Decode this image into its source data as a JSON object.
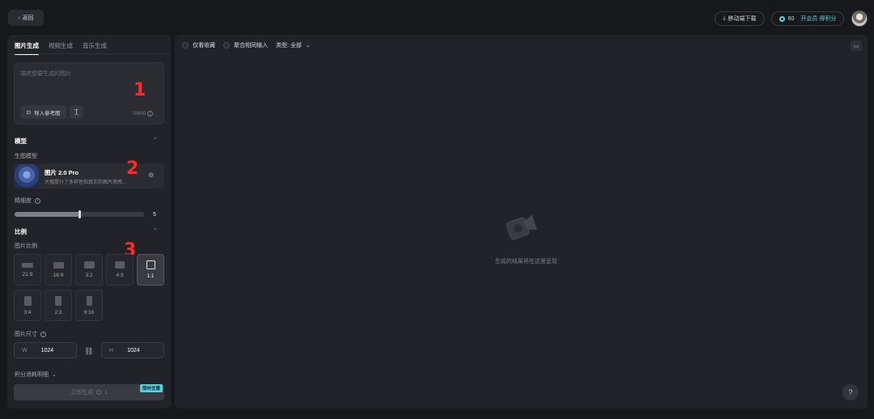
{
  "header": {
    "back_label": "返回",
    "download_label": "移动端下载",
    "credits_count": "60",
    "member_label": "开会员 得积分"
  },
  "sidebar": {
    "tabs": [
      {
        "label": "图片生成",
        "active": true
      },
      {
        "label": "视频生成",
        "active": false
      },
      {
        "label": "音乐生成",
        "active": false
      }
    ],
    "prompt": {
      "placeholder": "描述想要生成的图片",
      "ref_button_label": "导入参考图",
      "char_count": "0/800"
    },
    "model_section": {
      "title": "模型",
      "label": "生图模型",
      "model_name": "图片 2.0 Pro",
      "model_desc": "大幅提升了多样性和真实的图片质感..."
    },
    "fineness": {
      "label": "精细度",
      "value": "5",
      "level": 0.5
    },
    "ratio_section": {
      "title": "比例",
      "label": "图片比例",
      "options": [
        {
          "label": "21:9",
          "active": false
        },
        {
          "label": "16:9",
          "active": false
        },
        {
          "label": "3:2",
          "active": false
        },
        {
          "label": "4:3",
          "active": false
        },
        {
          "label": "1:1",
          "active": true
        },
        {
          "label": "3:4",
          "active": false
        },
        {
          "label": "2:3",
          "active": false
        },
        {
          "label": "9:16",
          "active": false
        }
      ]
    },
    "size": {
      "label": "图片尺寸",
      "width_prefix": "W",
      "width_value": "1024",
      "height_prefix": "H",
      "height_value": "1024"
    },
    "cost_label": "积分消耗明细",
    "generate_label": "立即生成",
    "generate_cost": "1",
    "promo_badge": "限时优惠"
  },
  "main": {
    "filter_favorites": "仅看收藏",
    "filter_aggregate": "聚合相同输入",
    "filter_type": "类型: 全部",
    "empty_text": "生成的结果将在这里呈现"
  },
  "markers": {
    "m1": "1",
    "m2": "2",
    "m3": "3"
  }
}
